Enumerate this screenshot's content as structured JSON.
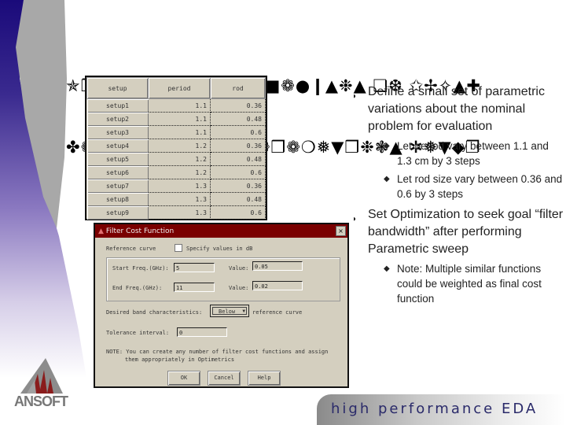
{
  "slide": {
    "title_line1": "✯❐▼❉❍❉❚❁▼❉❏■ ✡■❁●❙▲❉▲ ❏❆ ✩✢✧▲✚",
    "title_line2": "✤❁▲❅ ✲▼◆❄❙ ⊸✚ ✰❁❒❁❍❅▼❒❉❃▲ ✲❅▼◆❐"
  },
  "table": {
    "headers": [
      "setup",
      "period",
      "rod"
    ],
    "rows": [
      {
        "name": "setup1",
        "period": "1.1",
        "rod": "0.36"
      },
      {
        "name": "setup2",
        "period": "1.1",
        "rod": "0.48"
      },
      {
        "name": "setup3",
        "period": "1.1",
        "rod": "0.6"
      },
      {
        "name": "setup4",
        "period": "1.2",
        "rod": "0.36"
      },
      {
        "name": "setup5",
        "period": "1.2",
        "rod": "0.48"
      },
      {
        "name": "setup6",
        "period": "1.2",
        "rod": "0.6"
      },
      {
        "name": "setup7",
        "period": "1.3",
        "rod": "0.36"
      },
      {
        "name": "setup8",
        "period": "1.3",
        "rod": "0.48"
      },
      {
        "name": "setup9",
        "period": "1.3",
        "rod": "0.6"
      }
    ]
  },
  "dialog": {
    "title": "Filter Cost Function",
    "close_icon": "×",
    "reference_curve_label": "Reference curve",
    "specify_db_label": "Specify values in dB",
    "specify_db_checked": false,
    "start_freq_label": "Start Freq.(GHz):",
    "start_freq_value": "5",
    "start_value_label": "Value:",
    "start_value": "0.05",
    "end_freq_label": "End Freq.(GHz):",
    "end_freq_value": "11",
    "end_value_label": "Value:",
    "end_value": "0.02",
    "band_label": "Desired band characteristics:",
    "band_selected": "Below",
    "band_suffix": "reference curve",
    "tolerance_label": "Tolerance interval:",
    "tolerance_value": "0",
    "note_line1": "NOTE: You can create any number of filter cost functions and assign",
    "note_line2": "them appropriately in Optimetrics",
    "ok_label": "OK",
    "cancel_label": "Cancel",
    "help_label": "Help"
  },
  "bullets": [
    {
      "text": "Define a small set of parametric variations about the nominal problem for evaluation",
      "sub": [
        "Let period vary between 1.1 and 1.3 cm by 3 steps",
        "Let rod size vary between 0.36 and 0.6 by 3 steps"
      ]
    },
    {
      "text": "Set Optimization to seek goal “filter bandwidth” after performing Parametric sweep",
      "sub": [
        "Note: Multiple similar functions could be weighted as final cost function"
      ]
    }
  ],
  "branding": {
    "logo_text": "ANSOFT",
    "tagline": "high performance EDA"
  },
  "colors": {
    "dialog_title_bg": "#7a0000",
    "dialog_bg": "#d4cfbf",
    "tagline_color": "#2a2a6a",
    "wave_blue": "#1a0a7a"
  }
}
